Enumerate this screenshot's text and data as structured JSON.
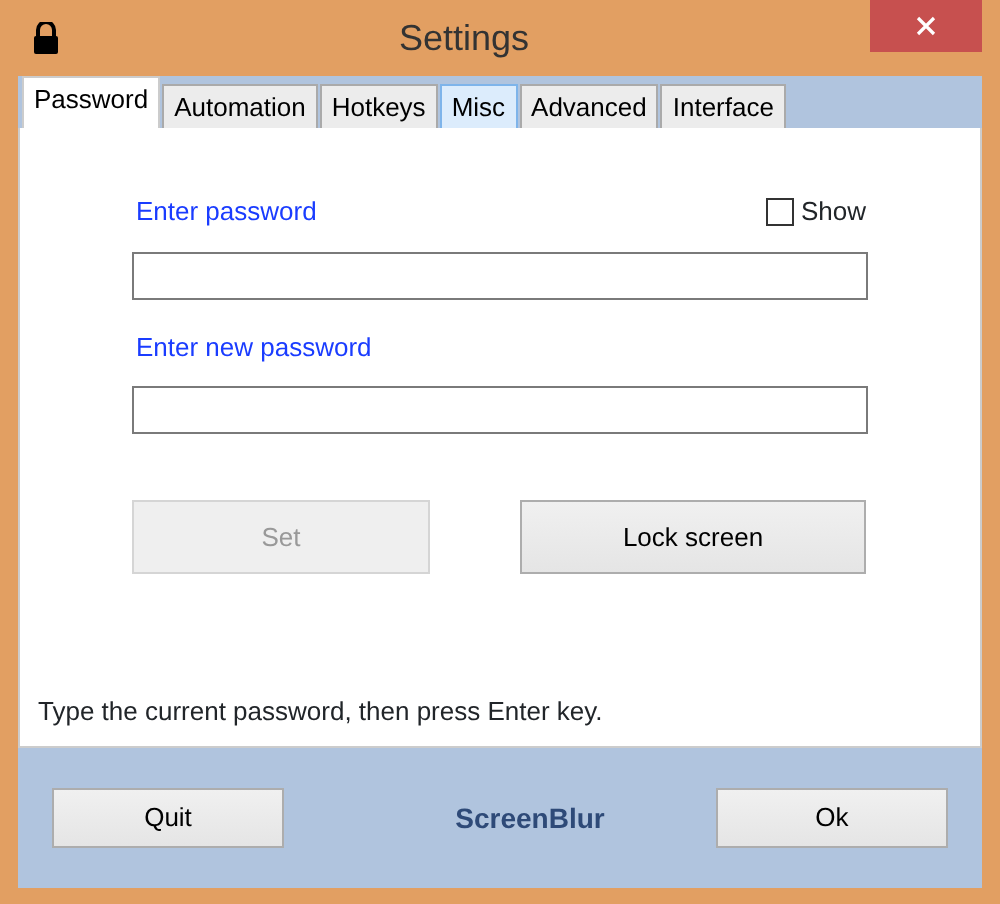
{
  "window": {
    "title": "Settings"
  },
  "tabs": [
    {
      "label": "Password",
      "selected": true,
      "hover": false
    },
    {
      "label": "Automation",
      "selected": false,
      "hover": false
    },
    {
      "label": "Hotkeys",
      "selected": false,
      "hover": false
    },
    {
      "label": "Misc",
      "selected": false,
      "hover": true
    },
    {
      "label": "Advanced",
      "selected": false,
      "hover": false
    },
    {
      "label": "Interface",
      "selected": false,
      "hover": false
    }
  ],
  "password": {
    "label": "Enter password",
    "show": {
      "label": "Show",
      "checked": false
    }
  },
  "new_password": {
    "label": "Enter new password"
  },
  "buttons": [
    {
      "label": "Set",
      "disabled": true
    },
    {
      "label": "Lock screen",
      "disabled": false
    }
  ],
  "hint": "Type the current password, then press Enter key.",
  "footer": {
    "buttons": [
      "Quit",
      "Ok"
    ],
    "app_name": "ScreenBlur"
  }
}
